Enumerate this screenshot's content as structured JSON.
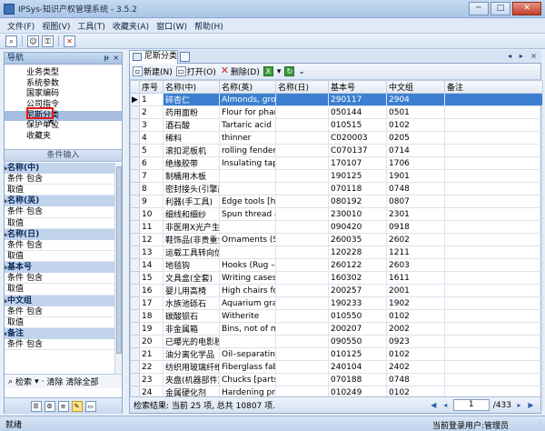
{
  "window": {
    "title": "IPSys-知识产权管理系统 - 3.5.2"
  },
  "window_buttons": {
    "minimize": "─",
    "maximize": "□",
    "close": "✕"
  },
  "menu": [
    "文件(F)",
    "视图(V)",
    "工具(T)",
    "收藏夹(A)",
    "窗口(W)",
    "帮助(H)"
  ],
  "nav": {
    "title": "导航",
    "pin": "ᵽ",
    "close": "×",
    "items": [
      "业务类型",
      "系统参数",
      "国家编码",
      "公司指令",
      "尼斯分类",
      "保护单位",
      "收藏夹"
    ],
    "selected_index": 4
  },
  "conditions": {
    "header": "条件输入",
    "groups": [
      {
        "title": "名称(中)",
        "rows": [
          {
            "k": "条件",
            "v": "包含"
          },
          {
            "k": "取值",
            "v": ""
          }
        ]
      },
      {
        "title": "名称(英)",
        "rows": [
          {
            "k": "条件",
            "v": "包含"
          },
          {
            "k": "取值",
            "v": ""
          }
        ]
      },
      {
        "title": "名称(日)",
        "rows": [
          {
            "k": "条件",
            "v": "包含"
          },
          {
            "k": "取值",
            "v": ""
          }
        ]
      },
      {
        "title": "基本号",
        "rows": [
          {
            "k": "条件",
            "v": "包含"
          },
          {
            "k": "取值",
            "v": ""
          }
        ]
      },
      {
        "title": "中文组",
        "rows": [
          {
            "k": "条件",
            "v": "包含"
          },
          {
            "k": "取值",
            "v": ""
          }
        ]
      },
      {
        "title": "备注",
        "rows": [
          {
            "k": "条件",
            "v": "包含"
          }
        ]
      }
    ],
    "search_label": "检索",
    "clear_label": "清除",
    "clear_all_label": "清除全部"
  },
  "doc_tab": {
    "label": "尼斯分类",
    "controls": "◂ ▸ ×"
  },
  "content_toolbar": {
    "new": "新建(N)",
    "open": "打开(O)",
    "delete": "删除(D)"
  },
  "grid": {
    "columns": [
      "序号",
      "名称(中)",
      "名称(英)",
      "名称(日)",
      "基本号",
      "中文组",
      "备注"
    ],
    "rows": [
      [
        "1",
        "碎杏仁",
        "Almonds, grou",
        "",
        "290117",
        "2904",
        ""
      ],
      [
        "2",
        "药用面粉",
        "Flour for pharn",
        "",
        "050144",
        "0501",
        ""
      ],
      [
        "3",
        "酒石酸",
        "Tartaric acid",
        "",
        "010515",
        "0102",
        ""
      ],
      [
        "4",
        "稀料",
        "thinner",
        "",
        "C020003",
        "0205",
        ""
      ],
      [
        "5",
        "滚扣泥板机",
        "rolling fenderb",
        "",
        "C070137",
        "0714",
        ""
      ],
      [
        "6",
        "绝缘胶带",
        "Insulating tape",
        "",
        "170107",
        "1706",
        ""
      ],
      [
        "7",
        "制桶用木板",
        "",
        "",
        "190125",
        "1901",
        ""
      ],
      [
        "8",
        "密封接头(引擎部",
        "",
        "",
        "070118",
        "0748",
        ""
      ],
      [
        "9",
        "利器(手工具)",
        "Edge tools [ha",
        "",
        "080192",
        "0807",
        ""
      ],
      [
        "10",
        "细线和细纱",
        "Spun thread ar",
        "",
        "230010",
        "2301",
        ""
      ],
      [
        "11",
        "非医用X光产生装",
        "",
        "",
        "090420",
        "0918",
        ""
      ],
      [
        "12",
        "鞋饰品(非贵重金",
        "Ornaments (Sh",
        "",
        "260035",
        "2602",
        ""
      ],
      [
        "13",
        "运载工具转向信号",
        "",
        "",
        "120228",
        "1211",
        ""
      ],
      [
        "14",
        "地毯钩",
        "Hooks (Rug –)",
        "",
        "260122",
        "2603",
        ""
      ],
      [
        "15",
        "文具盒(全套)",
        "Writing cases [",
        "",
        "160302",
        "1611",
        ""
      ],
      [
        "16",
        "婴儿用高椅",
        "High chairs for",
        "",
        "200257",
        "2001",
        ""
      ],
      [
        "17",
        "水族池砾石",
        "Aquarium grav",
        "",
        "190233",
        "1902",
        ""
      ],
      [
        "18",
        "碳酸钡石",
        "Witherite",
        "",
        "010550",
        "0102",
        ""
      ],
      [
        "19",
        "非金属箱",
        "Bins, not of me",
        "",
        "200207",
        "2002",
        ""
      ],
      [
        "20",
        "已曝光的电影胶片",
        "",
        "",
        "090550",
        "0923",
        ""
      ],
      [
        "21",
        "油分离化学品",
        "Oil–separating",
        "",
        "010125",
        "0102",
        ""
      ],
      [
        "22",
        "纺织用玻璃纤维",
        "Fiberglass fabr",
        "",
        "240104",
        "2402",
        ""
      ],
      [
        "23",
        "夹盘(机器部件)",
        "Chucks [parts c",
        "",
        "070188",
        "0748",
        ""
      ],
      [
        "24",
        "金属硬化剂",
        "Hardening prep",
        "",
        "010249",
        "0102",
        ""
      ],
      [
        "25",
        "铁箍",
        "Hoop iron [ ]",
        "",
        "060131",
        "0605",
        ""
      ]
    ]
  },
  "result": {
    "text": "检索结果: 当前 25 项, 总共 10807 项."
  },
  "pager": {
    "current": "1",
    "total": "/433"
  },
  "status": {
    "left": "就绪",
    "right": "当前登录用户:管理员",
    "grip": "⋰"
  }
}
